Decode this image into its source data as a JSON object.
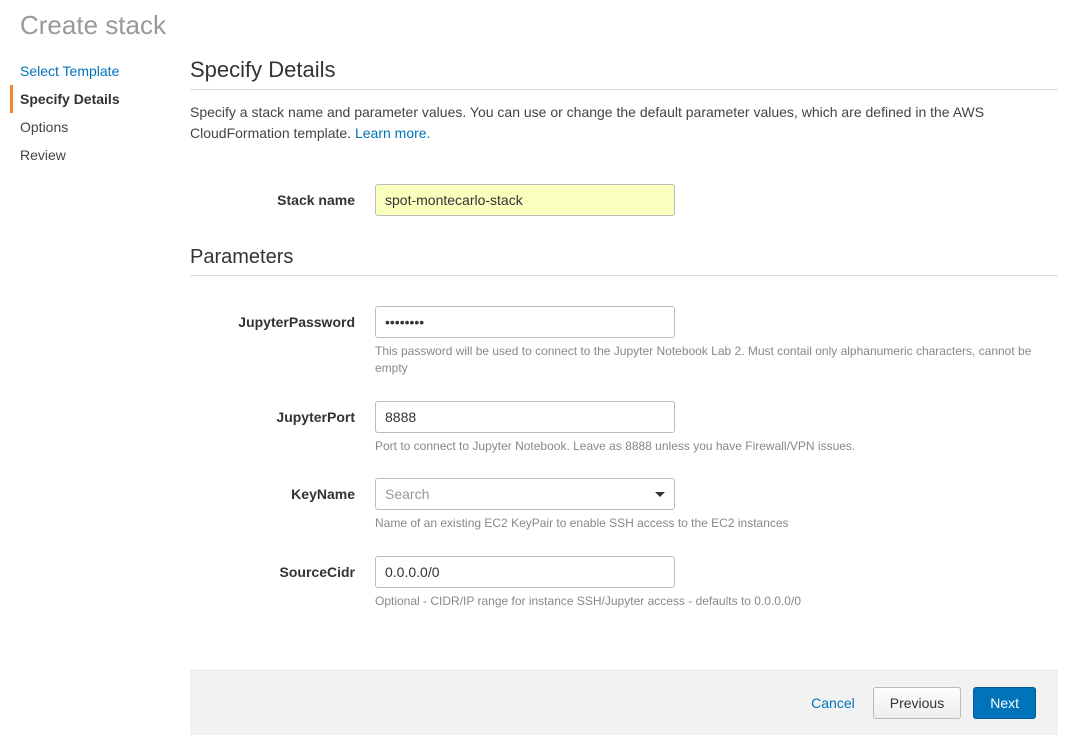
{
  "pageTitle": "Create stack",
  "sidebar": {
    "items": [
      {
        "label": "Select Template",
        "state": "completed"
      },
      {
        "label": "Specify Details",
        "state": "active"
      },
      {
        "label": "Options",
        "state": "upcoming"
      },
      {
        "label": "Review",
        "state": "upcoming"
      }
    ]
  },
  "details": {
    "heading": "Specify Details",
    "description": "Specify a stack name and parameter values. You can use or change the default parameter values, which are defined in the AWS CloudFormation template. ",
    "learnMore": "Learn more.",
    "stackNameLabel": "Stack name",
    "stackNameValue": "spot-montecarlo-stack"
  },
  "parameters": {
    "heading": "Parameters",
    "items": [
      {
        "key": "JupyterPassword",
        "value": "••••••••",
        "type": "password",
        "hint": "This password will be used to connect to the Jupyter Notebook Lab 2. Must contail only alphanumeric characters, cannot be empty"
      },
      {
        "key": "JupyterPort",
        "value": "8888",
        "type": "text",
        "hint": "Port to connect to Jupyter Notebook. Leave as 8888 unless you have Firewall/VPN issues."
      },
      {
        "key": "KeyName",
        "placeholder": "Search",
        "type": "combo",
        "hint": "Name of an existing EC2 KeyPair to enable SSH access to the EC2 instances"
      },
      {
        "key": "SourceCidr",
        "value": "0.0.0.0/0",
        "type": "text",
        "hint": "Optional - CIDR/IP range for instance SSH/Jupyter access - defaults to 0.0.0.0/0"
      }
    ]
  },
  "footer": {
    "cancel": "Cancel",
    "previous": "Previous",
    "next": "Next"
  }
}
